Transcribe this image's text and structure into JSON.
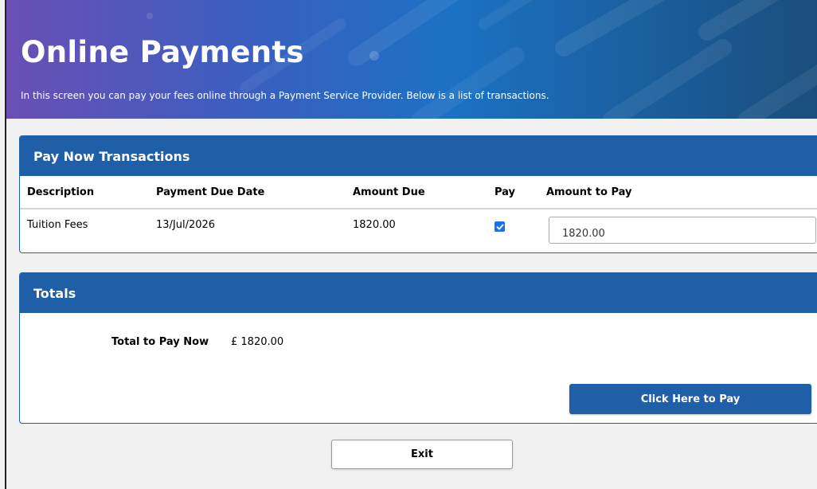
{
  "banner": {
    "title": "Online Payments",
    "subtitle": "In this screen you can pay your fees online through a Payment Service Provider. Below is a list of transactions."
  },
  "transactions": {
    "heading": "Pay Now Transactions",
    "columns": [
      "Description",
      "Payment Due Date",
      "Amount Due",
      "Pay",
      "Amount to Pay"
    ],
    "rows": [
      {
        "description": "Tuition Fees",
        "due_date": "13/Jul/2026",
        "amount_due": "1820.00",
        "pay_checked": true,
        "amount_to_pay": "1820.00"
      }
    ]
  },
  "totals": {
    "heading": "Totals",
    "label": "Total to Pay Now",
    "value": "£ 1820.00",
    "pay_button": "Click Here to Pay"
  },
  "exit_button": "Exit",
  "colors": {
    "primary": "#1f5fa8",
    "checkbox": "#1a73e8",
    "background": "#f1f1f1"
  }
}
